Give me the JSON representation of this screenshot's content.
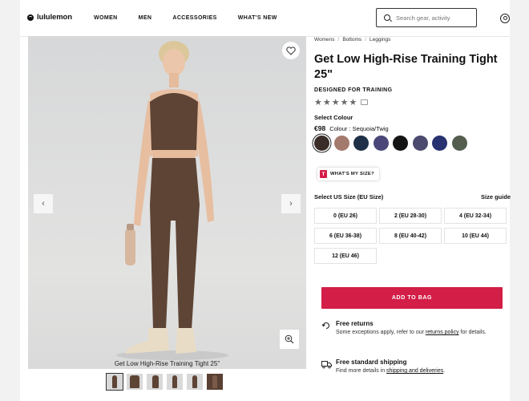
{
  "header": {
    "logo_text": "lululemon",
    "nav": [
      "WOMEN",
      "MEN",
      "ACCESSORIES",
      "WHAT'S NEW"
    ],
    "search_placeholder": "Search gear, activity"
  },
  "gallery": {
    "caption": "Get Low High-Rise Training Tight 25\"",
    "thumbnail_count": 6
  },
  "breadcrumb": [
    "Womens",
    "Bottoms",
    "Leggings"
  ],
  "product": {
    "title": "Get Low High-Rise Training Tight 25\"",
    "designed_for": "DESIGNED FOR TRAINING",
    "rating_stars": 5,
    "select_colour_label": "Select Colour",
    "price": "€98",
    "colour_text": "Colour : Sequoia/Twig",
    "swatches": [
      "#3a2d27",
      "#a47a6c",
      "#1d3047",
      "#4a4778",
      "#141414",
      "#4c4a6e",
      "#283270",
      "#545e4f"
    ],
    "selected_swatch": 0,
    "whats_my_size": "WHAT'S MY SIZE?",
    "select_size_label": "Select US Size (EU Size)",
    "size_guide": "Size guide",
    "sizes": [
      "0 (EU 26)",
      "2 (EU 28-30)",
      "4 (EU 32-34)",
      "6 (EU 36-38)",
      "8 (EU 40-42)",
      "10 (EU 44)",
      "12 (EU 46)"
    ],
    "add_to_bag": "ADD TO BAG"
  },
  "returns": {
    "heading": "Free returns",
    "text_before": "Some exceptions apply, refer to our ",
    "link": "returns policy",
    "text_after": " for details."
  },
  "shipping": {
    "heading": "Free standard shipping",
    "text_before": "Find more details in ",
    "link": "shipping and deliveries",
    "text_after": "."
  },
  "colors": {
    "accent_red": "#d31e47",
    "garment_brown": "#5e4435"
  }
}
